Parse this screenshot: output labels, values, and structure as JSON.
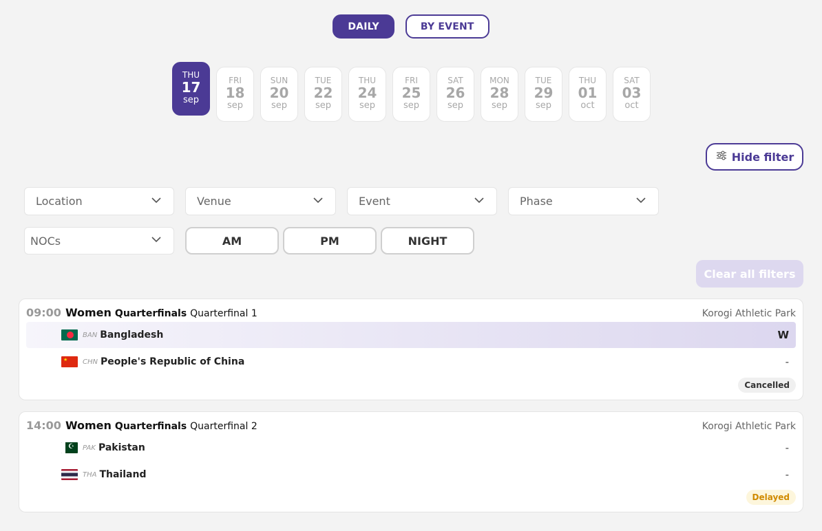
{
  "view_toggle": {
    "daily": "DAILY",
    "by_event": "BY EVENT"
  },
  "dates": [
    {
      "dow": "THU",
      "day": "17",
      "mon": "sep",
      "active": true
    },
    {
      "dow": "FRI",
      "day": "18",
      "mon": "sep"
    },
    {
      "dow": "SUN",
      "day": "20",
      "mon": "sep"
    },
    {
      "dow": "TUE",
      "day": "22",
      "mon": "sep"
    },
    {
      "dow": "THU",
      "day": "24",
      "mon": "sep"
    },
    {
      "dow": "FRI",
      "day": "25",
      "mon": "sep"
    },
    {
      "dow": "SAT",
      "day": "26",
      "mon": "sep"
    },
    {
      "dow": "MON",
      "day": "28",
      "mon": "sep"
    },
    {
      "dow": "TUE",
      "day": "29",
      "mon": "sep"
    },
    {
      "dow": "THU",
      "day": "01",
      "mon": "oct"
    },
    {
      "dow": "SAT",
      "day": "03",
      "mon": "oct"
    }
  ],
  "filters": {
    "hide_filter": "Hide filter",
    "location": "Location",
    "venue": "Venue",
    "event": "Event",
    "phase": "Phase",
    "nocs": "NOCs",
    "am": "AM",
    "pm": "PM",
    "night": "NIGHT",
    "clear_all": "Clear all filters"
  },
  "colors": {
    "accent": "#4b3a95",
    "delayed": "#d08a00"
  },
  "matches": [
    {
      "time": "09:00",
      "gender": "Women",
      "phase": "Quarterfinals",
      "unit": "Quarterfinal 1",
      "venue": "Korogi Athletic Park",
      "competitors": [
        {
          "code": "BAN",
          "country": "Bangladesh",
          "result": "W",
          "flag": "bangladesh-flag-icon"
        },
        {
          "code": "CHN",
          "country": "People's Republic of China",
          "result": "-",
          "flag": "china-flag-icon"
        }
      ],
      "status": "Cancelled"
    },
    {
      "time": "14:00",
      "gender": "Women",
      "phase": "Quarterfinals",
      "unit": "Quarterfinal 2",
      "venue": "Korogi Athletic Park",
      "competitors": [
        {
          "code": "PAK",
          "country": "Pakistan",
          "result": "-",
          "flag": "pakistan-flag-icon"
        },
        {
          "code": "THA",
          "country": "Thailand",
          "result": "-",
          "flag": "thailand-flag-icon"
        }
      ],
      "status": "Delayed"
    }
  ]
}
